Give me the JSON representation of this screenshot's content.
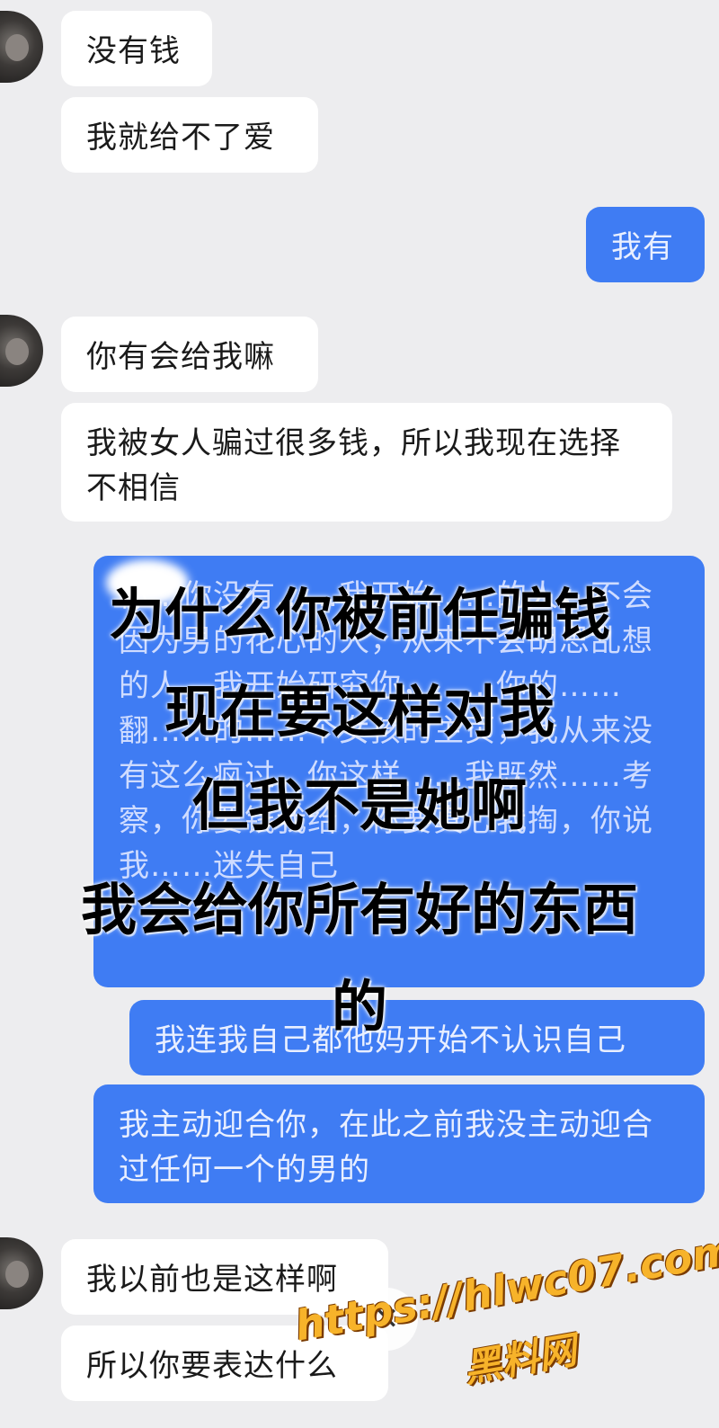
{
  "messages": [
    {
      "side": "left",
      "text": "没有钱"
    },
    {
      "side": "left",
      "text": "我就给不了爱"
    },
    {
      "side": "right",
      "text": "我有"
    },
    {
      "side": "left",
      "text": "你有会给我嘛"
    },
    {
      "side": "left",
      "text": "我被女人骗过很多钱，所以我现在选择不相信"
    },
    {
      "side": "right",
      "text": "你…你没有……我开始……的人，不会因为男的花心的人，从来不会胡思乱想的人，我开始研究你，……你的……翻……的……个女孩的主页，我从来没有这么疯过，你这样……我既然……考察，你要钱我给，你要真心我掏，你说我……迷失自己"
    },
    {
      "side": "right",
      "text": "我连我自己都他妈开始不认识自己"
    },
    {
      "side": "right",
      "text": "我主动迎合你，在此之前我没主动迎合过任何一个的男的"
    },
    {
      "side": "left",
      "text": "我以前也是这样啊"
    },
    {
      "side": "left",
      "text": "所以你要表达什么"
    }
  ],
  "overlay_caption": {
    "line1": "为什么你被前任骗钱",
    "line2": "现在要这样对我",
    "line3": "但我不是她啊",
    "line4": "我会给你所有好的东西",
    "line5": "的"
  },
  "watermark": {
    "url": "https://hlwc07.com",
    "name": "黑料网"
  },
  "colors": {
    "background": "#ededef",
    "left_bubble": "#ffffff",
    "right_bubble": "#3f7cf3",
    "watermark": "#f7b32a"
  }
}
